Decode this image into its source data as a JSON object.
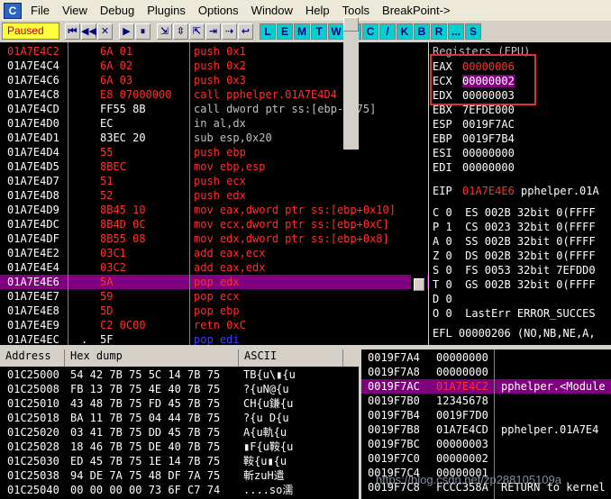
{
  "app_icon": "C",
  "menu": [
    "File",
    "View",
    "Debug",
    "Plugins",
    "Options",
    "Window",
    "Help",
    "Tools",
    "BreakPoint->"
  ],
  "status": "Paused",
  "toolbar_left": [
    "⏮",
    "◀◀",
    "✕",
    "▶",
    "⏸",
    "⇲",
    "⇳",
    "⇱",
    "⇥",
    "⇢",
    "↩"
  ],
  "toolbar_letters": [
    "L",
    "E",
    "M",
    "T",
    "W",
    "H",
    "C",
    "/",
    "K",
    "B",
    "R",
    "...",
    "S"
  ],
  "disasm": [
    {
      "addr": "01A7E4C2",
      "addr_red": true,
      "mark": "",
      "hex": "6A 01",
      "hex_red": true,
      "asm": "push 0x1",
      "asm_style": "red",
      "sel": false
    },
    {
      "addr": "01A7E4C4",
      "addr_red": false,
      "mark": "",
      "hex": "6A 02",
      "hex_red": true,
      "asm": "push 0x2",
      "asm_style": "red",
      "sel": false
    },
    {
      "addr": "01A7E4C6",
      "addr_red": false,
      "mark": "",
      "hex": "6A 03",
      "hex_red": true,
      "asm": "push 0x3",
      "asm_style": "red",
      "sel": false
    },
    {
      "addr": "01A7E4C8",
      "addr_red": false,
      "mark": "",
      "hex": "E8 07000000",
      "hex_red": true,
      "asm": "call pphelper.01A7E4D4",
      "asm_style": "red",
      "sel": false
    },
    {
      "addr": "01A7E4CD",
      "addr_red": false,
      "mark": "",
      "hex": "FF55 8B",
      "hex_red": false,
      "asm": "call dword ptr ss:[ebp-0x75]",
      "asm_style": "grey",
      "sel": false
    },
    {
      "addr": "01A7E4D0",
      "addr_red": false,
      "mark": "",
      "hex": "EC",
      "hex_red": false,
      "asm": "in al,dx",
      "asm_style": "grey",
      "sel": false
    },
    {
      "addr": "01A7E4D1",
      "addr_red": false,
      "mark": "",
      "hex": "83EC 20",
      "hex_red": false,
      "asm": "sub esp,0x20",
      "asm_style": "grey",
      "sel": false
    },
    {
      "addr": "01A7E4D4",
      "addr_red": false,
      "mark": "",
      "hex": "55",
      "hex_red": true,
      "asm": "push ebp",
      "asm_style": "red",
      "sel": false
    },
    {
      "addr": "01A7E4D5",
      "addr_red": false,
      "mark": "",
      "hex": "8BEC",
      "hex_red": true,
      "asm": "mov ebp,esp",
      "asm_style": "red",
      "sel": false
    },
    {
      "addr": "01A7E4D7",
      "addr_red": false,
      "mark": "",
      "hex": "51",
      "hex_red": true,
      "asm": "push ecx",
      "asm_style": "red",
      "sel": false
    },
    {
      "addr": "01A7E4D8",
      "addr_red": false,
      "mark": "",
      "hex": "52",
      "hex_red": true,
      "asm": "push edx",
      "asm_style": "red",
      "sel": false
    },
    {
      "addr": "01A7E4D9",
      "addr_red": false,
      "mark": "",
      "hex": "8B45 10",
      "hex_red": true,
      "asm": "mov eax,dword ptr ss:[ebp+0x10]",
      "asm_style": "red",
      "sel": false
    },
    {
      "addr": "01A7E4DC",
      "addr_red": false,
      "mark": "",
      "hex": "8B4D 0C",
      "hex_red": true,
      "asm": "mov ecx,dword ptr ss:[ebp+0xC]",
      "asm_style": "red",
      "sel": false
    },
    {
      "addr": "01A7E4DF",
      "addr_red": false,
      "mark": "",
      "hex": "8B55 08",
      "hex_red": true,
      "asm": "mov edx,dword ptr ss:[ebp+0x8]",
      "asm_style": "red",
      "sel": false
    },
    {
      "addr": "01A7E4E2",
      "addr_red": false,
      "mark": "",
      "hex": "03C1",
      "hex_red": true,
      "asm": "add eax,ecx",
      "asm_style": "red",
      "sel": false
    },
    {
      "addr": "01A7E4E4",
      "addr_red": false,
      "mark": "",
      "hex": "03C2",
      "hex_red": true,
      "asm": "add eax,edx",
      "asm_style": "red",
      "sel": false
    },
    {
      "addr": "01A7E4E6",
      "addr_red": false,
      "mark": "",
      "hex": "5A",
      "hex_red": true,
      "asm": "pop edx",
      "asm_style": "red",
      "sel": true
    },
    {
      "addr": "01A7E4E7",
      "addr_red": false,
      "mark": "",
      "hex": "59",
      "hex_red": true,
      "asm": "pop ecx",
      "asm_style": "red",
      "sel": false
    },
    {
      "addr": "01A7E4E8",
      "addr_red": false,
      "mark": "",
      "hex": "5D",
      "hex_red": true,
      "asm": "pop ebp",
      "asm_style": "red",
      "sel": false
    },
    {
      "addr": "01A7E4E9",
      "addr_red": false,
      "mark": "",
      "hex": "C2 0C00",
      "hex_red": true,
      "asm": "retn 0xC",
      "asm_style": "red",
      "sel": false
    },
    {
      "addr": "01A7E4EC",
      "addr_red": false,
      "mark": ".",
      "hex": "5F",
      "hex_red": false,
      "asm": "pop edi",
      "asm_style": "blue",
      "sel": false
    }
  ],
  "registers": {
    "title": "Registers (FPU)",
    "main": [
      {
        "name": "EAX",
        "val": "00000006",
        "style": "red"
      },
      {
        "name": "ECX",
        "val": "00000002",
        "style": "hl"
      },
      {
        "name": "EDX",
        "val": "00000003",
        "style": "plain"
      },
      {
        "name": "EBX",
        "val": "7EFDE000",
        "style": "plain"
      },
      {
        "name": "ESP",
        "val": "0019F7AC",
        "style": "plain"
      },
      {
        "name": "EBP",
        "val": "0019F7B4",
        "style": "plain"
      },
      {
        "name": "ESI",
        "val": "00000000",
        "style": "plain"
      },
      {
        "name": "EDI",
        "val": "00000000",
        "style": "plain"
      }
    ],
    "eip": {
      "name": "EIP",
      "val": "01A7E4E6",
      "rest": " pphelper.01A"
    },
    "flags": [
      "C 0  ES 002B 32bit 0(FFFF",
      "P 1  CS 0023 32bit 0(FFFF",
      "A 0  SS 002B 32bit 0(FFFF",
      "Z 0  DS 002B 32bit 0(FFFF",
      "S 0  FS 0053 32bit 7EFDD0",
      "T 0  GS 002B 32bit 0(FFFF",
      "D 0",
      "O 0  LastErr ERROR_SUCCES"
    ],
    "efl": "EFL 00000206 (NO,NB,NE,A,"
  },
  "dump": {
    "headers": [
      "Address",
      "Hex dump",
      "ASCII"
    ],
    "rows": [
      {
        "addr": "01C25000",
        "hex": "54 42 7B 75 5C 14 7B 75",
        "ascii": "TB{u\\▮{u"
      },
      {
        "addr": "01C25008",
        "hex": "FB 13 7B 75 4E 40 7B 75",
        "ascii": "?{uN@{u"
      },
      {
        "addr": "01C25010",
        "hex": "43 48 7B 75 FD 45 7B 75",
        "ascii": "CH{u鎌{u"
      },
      {
        "addr": "01C25018",
        "hex": "BA 11 7B 75 04 44 7B 75",
        "ascii": "?{u D{u"
      },
      {
        "addr": "01C25020",
        "hex": "03 41 7B 75 DD 45 7B 75",
        "ascii": "A{u軌{u"
      },
      {
        "addr": "01C25028",
        "hex": "18 46 7B 75 DE 40 7B 75",
        "ascii": "▮F{u鞍{u"
      },
      {
        "addr": "01C25030",
        "hex": "ED 45 7B 75 1E 14 7B 75",
        "ascii": "鞍{u▮{u"
      },
      {
        "addr": "01C25038",
        "hex": "94 DE 7A 75 48 DF 7A 75",
        "ascii": "斬zuH遣"
      },
      {
        "addr": "01C25040",
        "hex": "00 00 00 00 73 6F C7 74",
        "ascii": "....so濡"
      }
    ]
  },
  "stack": [
    {
      "addr": "0019F7A4",
      "val": "00000000",
      "cmt": "",
      "sel": false
    },
    {
      "addr": "0019F7A8",
      "val": "00000000",
      "cmt": "",
      "sel": false
    },
    {
      "addr": "0019F7AC",
      "val": "01A7E4C2",
      "cmt": "pphelper.<Module",
      "sel": true
    },
    {
      "addr": "0019F7B0",
      "val": "12345678",
      "cmt": "",
      "sel": false
    },
    {
      "addr": "0019F7B4",
      "val": "0019F7D0",
      "cmt": "",
      "sel": false
    },
    {
      "addr": "0019F7B8",
      "val": "01A7E4CD",
      "cmt": "pphelper.01A7E4",
      "sel": false
    },
    {
      "addr": "0019F7BC",
      "val": "00000003",
      "cmt": "",
      "sel": false
    },
    {
      "addr": "0019F7C0",
      "val": "00000002",
      "cmt": "",
      "sel": false
    },
    {
      "addr": "0019F7C4",
      "val": "00000001",
      "cmt": "",
      "sel": false
    },
    {
      "addr": "0019F7C8",
      "val": "FCCC358A",
      "cmt": "RETURN to kernel",
      "sel": false
    }
  ],
  "watermark": "https://blog.csdn.net/zp288105109a",
  "colors": {
    "accent_red": "#ff3030",
    "select_purple": "#800080",
    "status_yellow": "#ffff40",
    "highlight_box": "#e03030"
  }
}
